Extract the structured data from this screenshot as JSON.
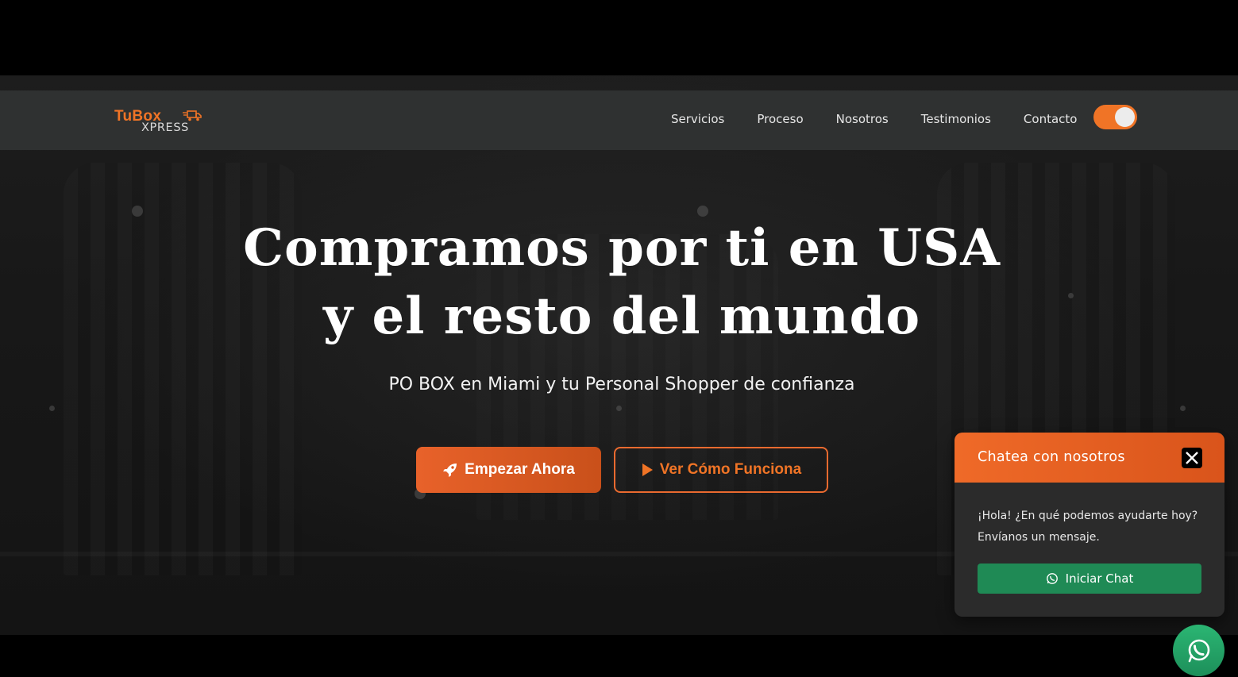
{
  "brand": {
    "logo_top": "TuBox",
    "logo_bottom": "XPRESS"
  },
  "nav": {
    "links": [
      "Servicios",
      "Proceso",
      "Nosotros",
      "Testimonios",
      "Contacto"
    ],
    "theme_toggle": "on"
  },
  "hero": {
    "headline_line1": "Compramos por ti en USA",
    "headline_line2": "y el resto del mundo",
    "subtitle": "PO BOX en Miami y tu Personal Shopper de confianza",
    "primary_button": "Empezar Ahora",
    "secondary_button": "Ver Cómo Funciona"
  },
  "chat": {
    "title": "Chatea con nosotros",
    "message": "¡Hola! ¿En qué podemos ayudarte hoy? Envíanos un mensaje.",
    "start_button": "Iniciar Chat"
  },
  "icons": {
    "primary_button_icon": "rocket-icon",
    "secondary_button_icon": "play-icon",
    "chat_close": "close-icon",
    "chat_button_icon": "whatsapp-icon",
    "fab": "whatsapp-icon"
  },
  "colors": {
    "accent": "#f07426",
    "navbar": "#2f3131",
    "whatsapp_green": "#1f8a55"
  }
}
